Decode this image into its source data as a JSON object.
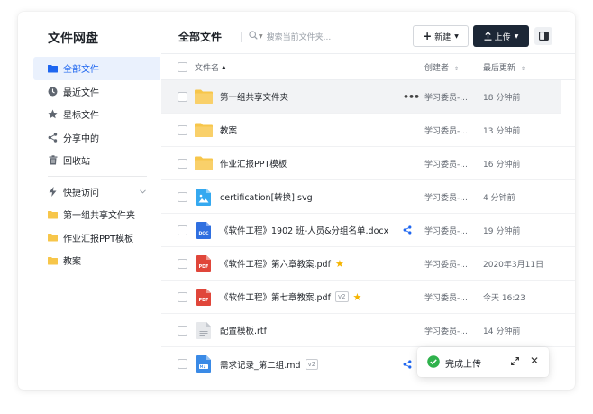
{
  "app": {
    "title": "文件网盘"
  },
  "sidebar": {
    "items": [
      {
        "label": "全部文件",
        "icon": "folder-icon",
        "active": true
      },
      {
        "label": "最近文件",
        "icon": "clock-icon"
      },
      {
        "label": "星标文件",
        "icon": "star-icon"
      },
      {
        "label": "分享中的",
        "icon": "share-icon"
      },
      {
        "label": "回收站",
        "icon": "trash-icon"
      }
    ],
    "quick_access": {
      "label": "快捷访问",
      "items": [
        {
          "label": "第一组共享文件夹"
        },
        {
          "label": "作业汇报PPT模板"
        },
        {
          "label": "教案"
        }
      ]
    }
  },
  "main": {
    "title": "全部文件",
    "search_placeholder": "搜索当前文件夹...",
    "new_button": "新建",
    "upload_button": "上传",
    "columns": {
      "name": "文件名",
      "creator": "创建者",
      "updated": "最后更新"
    }
  },
  "files": [
    {
      "name": "第一组共享文件夹",
      "type": "folder",
      "creator": "学习委员-...",
      "updated": "18 分钟前"
    },
    {
      "name": "教案",
      "type": "folder",
      "creator": "学习委员-...",
      "updated": "13 分钟前"
    },
    {
      "name": "作业汇报PPT模板",
      "type": "folder",
      "creator": "学习委员-...",
      "updated": "16 分钟前"
    },
    {
      "name": "certification[转换].svg",
      "type": "image",
      "creator": "学习委员-...",
      "updated": "4 分钟前"
    },
    {
      "name": "《软件工程》1902 班-人员&分组名单.docx",
      "type": "doc",
      "creator": "学习委员-...",
      "updated": "19 分钟前"
    },
    {
      "name": "《软件工程》第六章教案.pdf",
      "type": "pdf",
      "creator": "学习委员-...",
      "updated": "2020年3月11日"
    },
    {
      "name": "《软件工程》第七章教案.pdf",
      "type": "pdf",
      "version": "v2",
      "creator": "学习委员-...",
      "updated": "今天 16:23"
    },
    {
      "name": "配置模板.rtf",
      "type": "rtf",
      "creator": "学习委员-...",
      "updated": "14 分钟前"
    },
    {
      "name": "需求记录_第二组.md",
      "type": "md",
      "version": "v2"
    }
  ],
  "file_icon_labels": {
    "doc": "DOC",
    "pdf": "PDF"
  },
  "toast": {
    "message": "完成上传"
  },
  "colors": {
    "accent": "#1e66f0",
    "folder": "#f7c64a",
    "pdf": "#e0463a",
    "doc": "#2f6fe0",
    "dark_button": "#1c2736",
    "success": "#2fb24c",
    "star": "#f5b400"
  }
}
